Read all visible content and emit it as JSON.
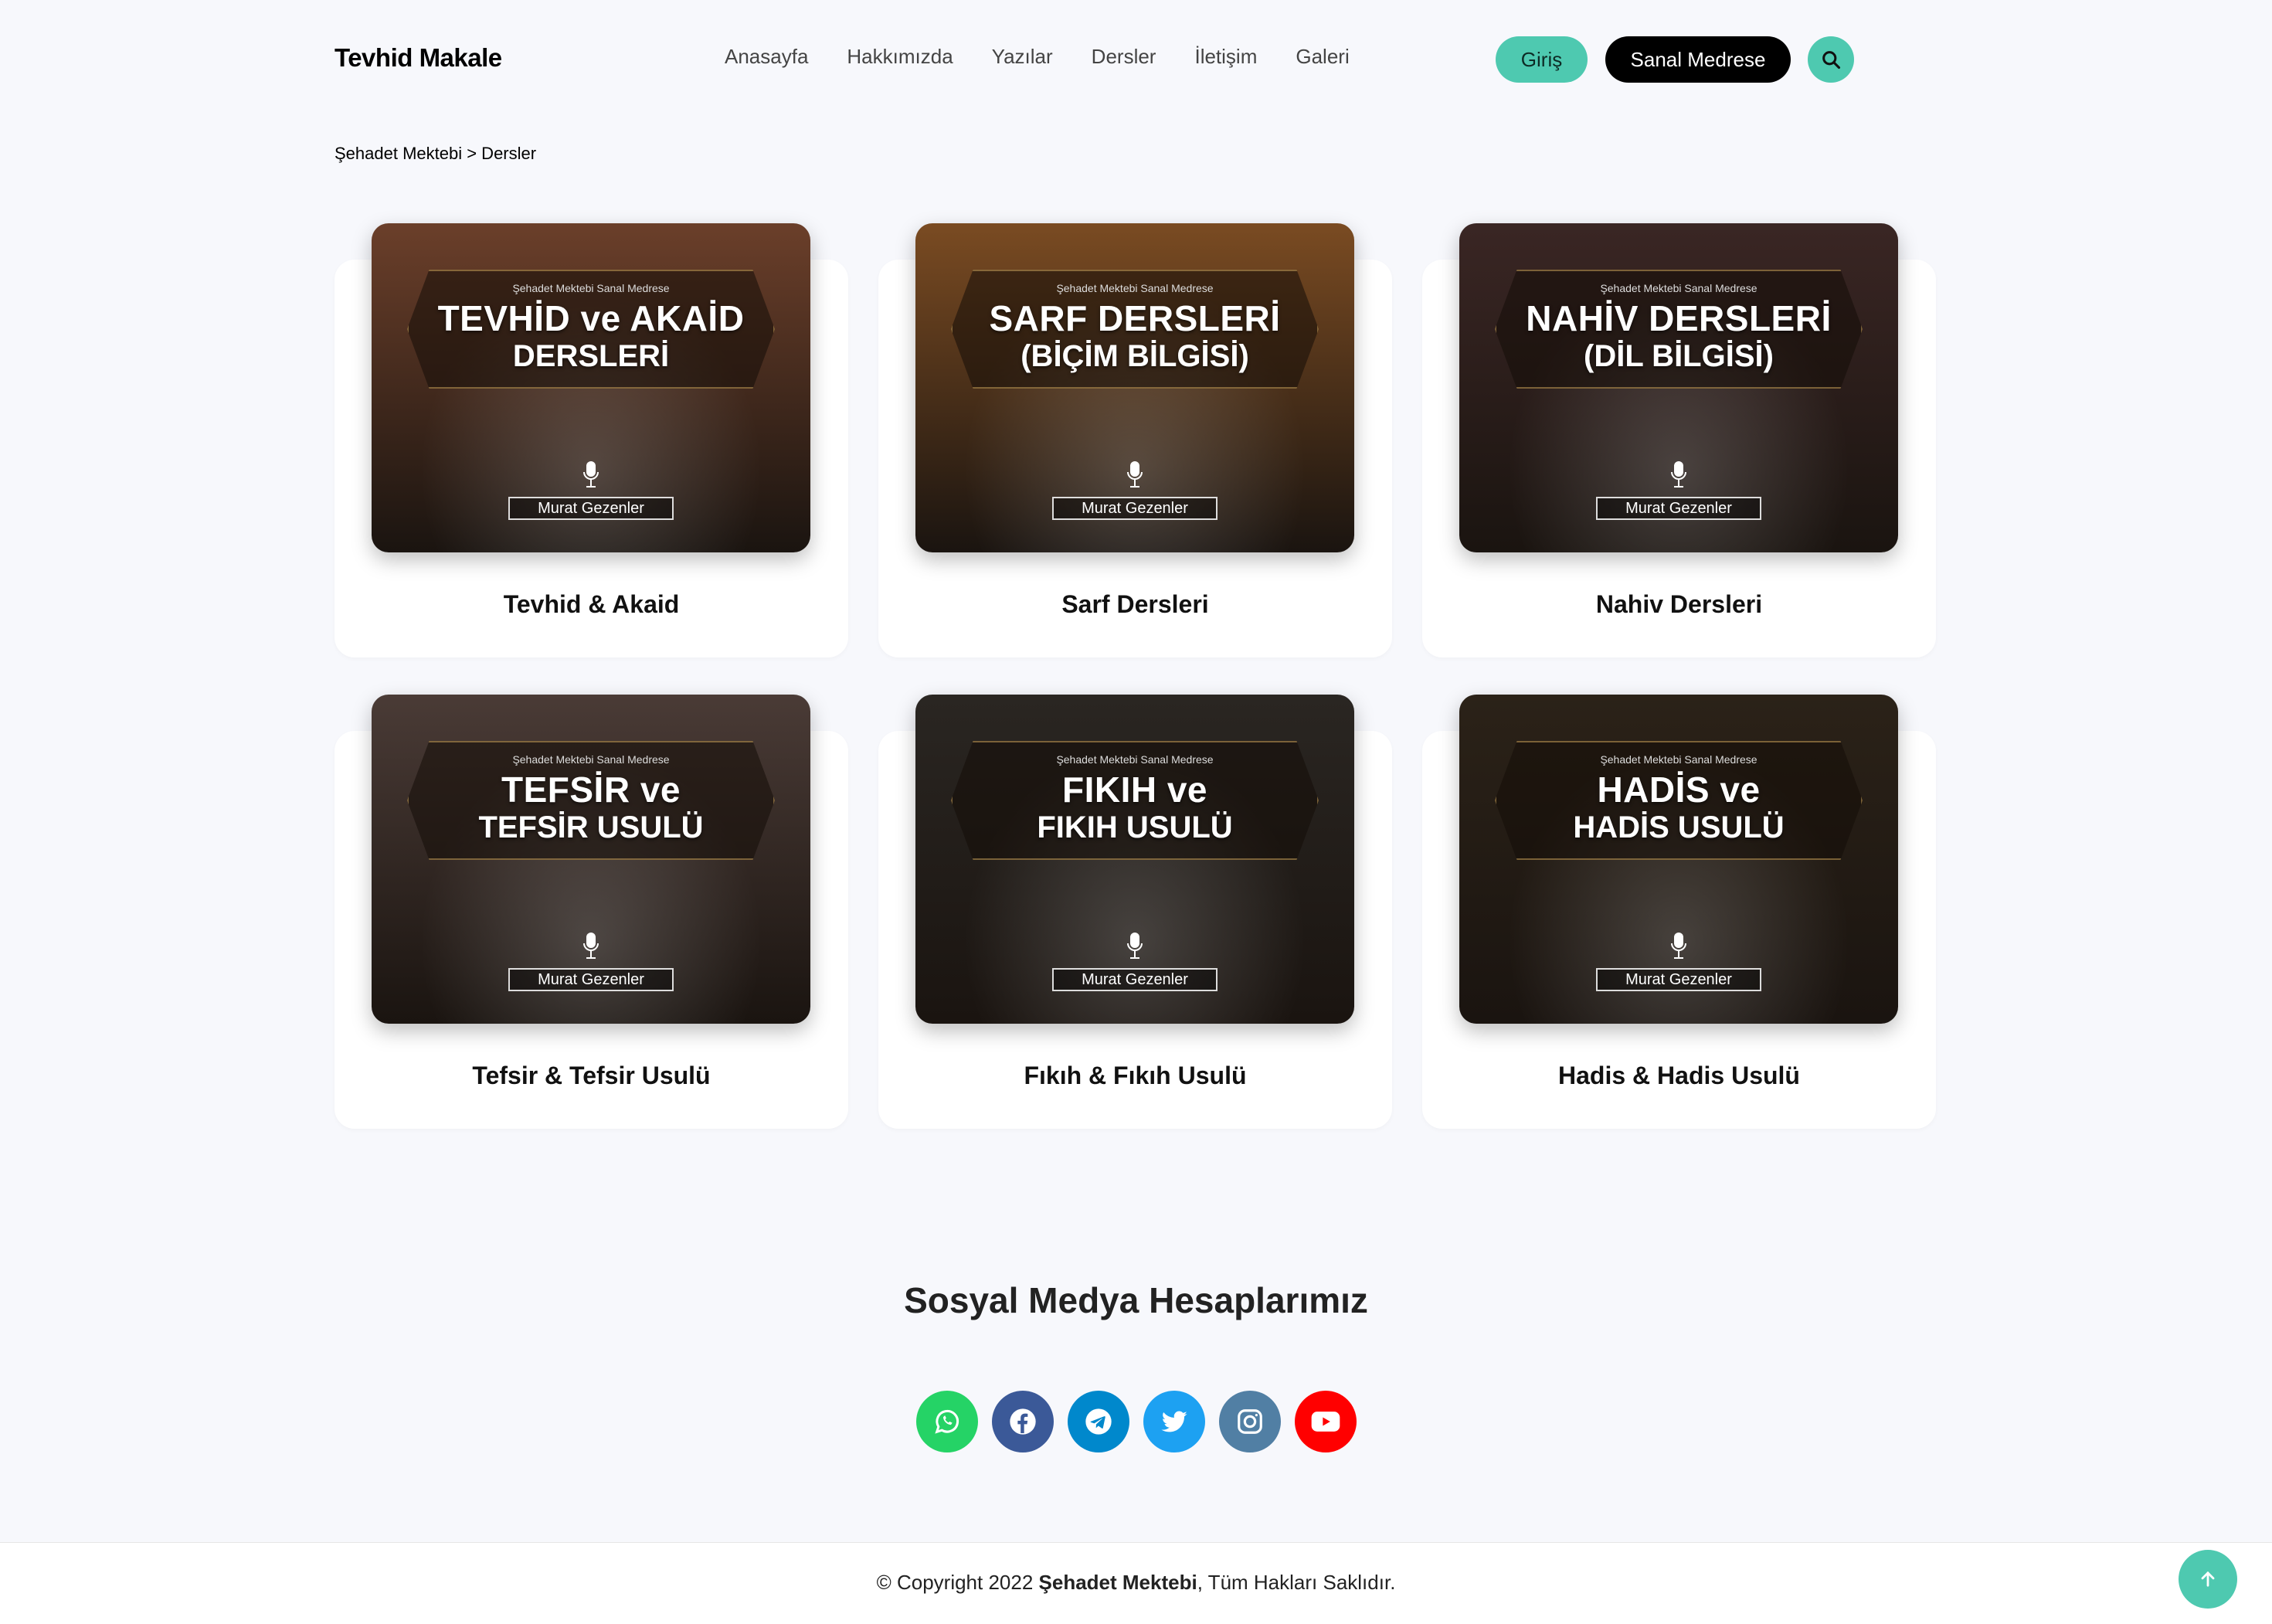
{
  "header": {
    "logo": "Tevhid Makale",
    "nav": [
      "Anasayfa",
      "Hakkımızda",
      "Yazılar",
      "Dersler",
      "İletişim",
      "Galeri"
    ],
    "login_label": "Giriş",
    "medrese_label": "Sanal Medrese",
    "search_icon": "search-icon"
  },
  "breadcrumb": "Şehadet Mektebi > Dersler",
  "cards": [
    {
      "title": "Tevhid & Akaid",
      "banner_small": "Şehadet Mektebi Sanal Medrese",
      "banner_l1": "TEVHİD ve AKAİD",
      "banner_l2": "DERSLERİ",
      "author": "Murat Gezenler",
      "bg": "#6b3f2a"
    },
    {
      "title": "Sarf Dersleri",
      "banner_small": "Şehadet Mektebi Sanal Medrese",
      "banner_l1": "SARF DERSLERİ",
      "banner_l2": "(BİÇİM BİLGİSİ)",
      "author": "Murat Gezenler",
      "bg": "#7a4b22"
    },
    {
      "title": "Nahiv Dersleri",
      "banner_small": "Şehadet Mektebi Sanal Medrese",
      "banner_l1": "NAHİV DERSLERİ",
      "banner_l2": "(DİL BİLGİSİ)",
      "author": "Murat Gezenler",
      "bg": "#3a2624"
    },
    {
      "title": "Tefsir & Tefsir Usulü",
      "banner_small": "Şehadet Mektebi Sanal Medrese",
      "banner_l1": "TEFSİR ve",
      "banner_l2": "TEFSİR USULÜ",
      "author": "Murat Gezenler",
      "bg": "#4a3b36"
    },
    {
      "title": "Fıkıh & Fıkıh Usulü",
      "banner_small": "Şehadet Mektebi Sanal Medrese",
      "banner_l1": "FIKIH ve",
      "banner_l2": "FIKIH USULÜ",
      "author": "Murat Gezenler",
      "bg": "#2a2622"
    },
    {
      "title": "Hadis & Hadis Usulü",
      "banner_small": "Şehadet Mektebi Sanal Medrese",
      "banner_l1": "HADİS ve",
      "banner_l2": "HADİS USULÜ",
      "author": "Murat Gezenler",
      "bg": "#2b2218"
    }
  ],
  "social": {
    "title": "Sosyal Medya Hesaplarımız",
    "items": [
      {
        "name": "whatsapp-icon",
        "color": "#25d366"
      },
      {
        "name": "facebook-icon",
        "color": "#3b5998"
      },
      {
        "name": "telegram-icon",
        "color": "#0088cc"
      },
      {
        "name": "twitter-icon",
        "color": "#1da1f2"
      },
      {
        "name": "instagram-icon",
        "color": "#517fa4"
      },
      {
        "name": "youtube-icon",
        "color": "#ff0000"
      }
    ]
  },
  "footer": {
    "prefix": "© Copyright 2022 ",
    "brand": "Şehadet Mektebi",
    "suffix": ", Tüm Hakları Saklıdır."
  },
  "colors": {
    "accent": "#4ec9b0",
    "dark": "#000000"
  }
}
